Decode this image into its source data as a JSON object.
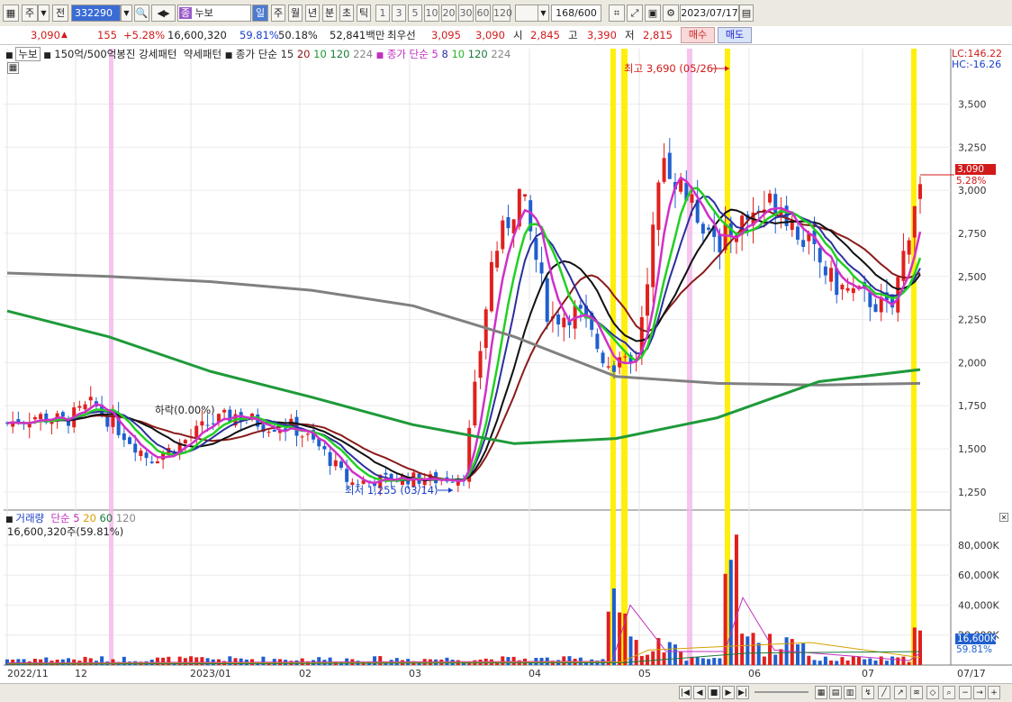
{
  "toolbar": {
    "market_label": "주",
    "prev_label": "전",
    "code": "332290",
    "name": "누보",
    "name_badge": "종",
    "periods": [
      "일",
      "주",
      "월",
      "년",
      "분",
      "초",
      "틱"
    ],
    "numbers": [
      "1",
      "3",
      "5",
      "10",
      "20",
      "30",
      "60",
      "120"
    ],
    "count": "168",
    "total": "/600",
    "date": "2023/07/17"
  },
  "info": {
    "price": "3,090",
    "change": "155",
    "change_pct": "+5.28%",
    "volume": "16,600,320",
    "vol_ratio": "59.81%",
    "turnover": "50.18%",
    "amount": "52,841백만",
    "best_ask_label": "최우선",
    "best_ask": "3,095",
    "best_bid": "3,090",
    "open_label": "시",
    "open": "2,845",
    "high_label": "고",
    "high": "3,390",
    "low_label": "저",
    "low": "2,815",
    "buy_label": "매수",
    "sell_label": "매도"
  },
  "legend": {
    "stock": "누보",
    "pattern": "150억/500억봉진 강세패턴",
    "weak": "약세패턴",
    "close_ma_label": "종가 단순",
    "close_ma_values": [
      "15",
      "20",
      "10",
      "120",
      "224"
    ],
    "close_ma2_label": "종가 단순",
    "close_ma2_values": [
      "5",
      "8",
      "10",
      "120",
      "224"
    ],
    "lc": "LC:146.22",
    "hc": "HC:-16.26"
  },
  "annotations": {
    "high": "최고 3,690 (05/26)",
    "low": "최저 1,255 (03/14)",
    "drop": "하락(0.00%)",
    "price_tag": "3,090",
    "pct_tag": "5.28%"
  },
  "volume_legend": {
    "label": "거래량",
    "ma_label": "단순",
    "ma_values": [
      "5",
      "20",
      "60",
      "120"
    ],
    "current": "16,600,320주(59.81%)",
    "tag": "16,600K",
    "tag_pct": "59.81%"
  },
  "price_axis": [
    "3,500",
    "3,250",
    "3,000",
    "2,750",
    "2,500",
    "2,250",
    "2,000",
    "1,750",
    "1,500",
    "1,250"
  ],
  "volume_axis": [
    "80,000K",
    "60,000K",
    "40,000K",
    "20,000K"
  ],
  "time_axis": [
    "2022/11",
    "12",
    "2023/01",
    "02",
    "03",
    "04",
    "05",
    "06",
    "07",
    "07/17"
  ],
  "colors": {
    "up": "#e0201e",
    "down": "#1f5fcf",
    "highlight_yellow": "#ffee00",
    "highlight_pink": "#f4b6e8",
    "ma224": "#808080",
    "ma120": "#1e9a3a"
  },
  "chart_data": {
    "type": "candlestick",
    "series": [
      {
        "name": "MA5",
        "color": "#d030c8"
      },
      {
        "name": "MA10",
        "color": "#2c2f9e"
      },
      {
        "name": "MA20",
        "color": "#22c822"
      },
      {
        "name": "MA120",
        "color": "#1e9a3a"
      },
      {
        "name": "MA224",
        "color": "#808080"
      }
    ],
    "ylim": [
      1150,
      3780
    ],
    "close_path": [
      [
        "2022/11",
        1650
      ],
      [
        "2022/11",
        1690
      ],
      [
        "2022/12",
        1660
      ],
      [
        "2022/12",
        1760
      ],
      [
        "2022/12",
        1600
      ],
      [
        "2023/01",
        1440
      ],
      [
        "2023/01",
        1520
      ],
      [
        "2023/01",
        1640
      ],
      [
        "2023/02",
        1700
      ],
      [
        "2023/02",
        1640
      ],
      [
        "2023/02",
        1630
      ],
      [
        "2023/03",
        1500
      ],
      [
        "2023/03",
        1300
      ],
      [
        "2023/03",
        1320
      ],
      [
        "2023/03",
        1330
      ],
      [
        "2023/04",
        1320
      ],
      [
        "2023/04",
        1350
      ],
      [
        "2023/04",
        2600
      ],
      [
        "2023/04",
        3000
      ],
      [
        "2023/05",
        2250
      ],
      [
        "2023/05",
        2300
      ],
      [
        "2023/05",
        2000
      ],
      [
        "2023/05",
        1980
      ],
      [
        "2023/05",
        3200
      ],
      [
        "2023/06",
        2900
      ],
      [
        "2023/06",
        2700
      ],
      [
        "2023/06",
        2850
      ],
      [
        "2023/06",
        2950
      ],
      [
        "2023/06",
        2700
      ],
      [
        "2023/07",
        2450
      ],
      [
        "2023/07",
        2380
      ],
      [
        "2023/07",
        2300
      ],
      [
        "2023/07",
        3090
      ]
    ],
    "last_close": 3090,
    "high": 3690,
    "low": 1255
  }
}
